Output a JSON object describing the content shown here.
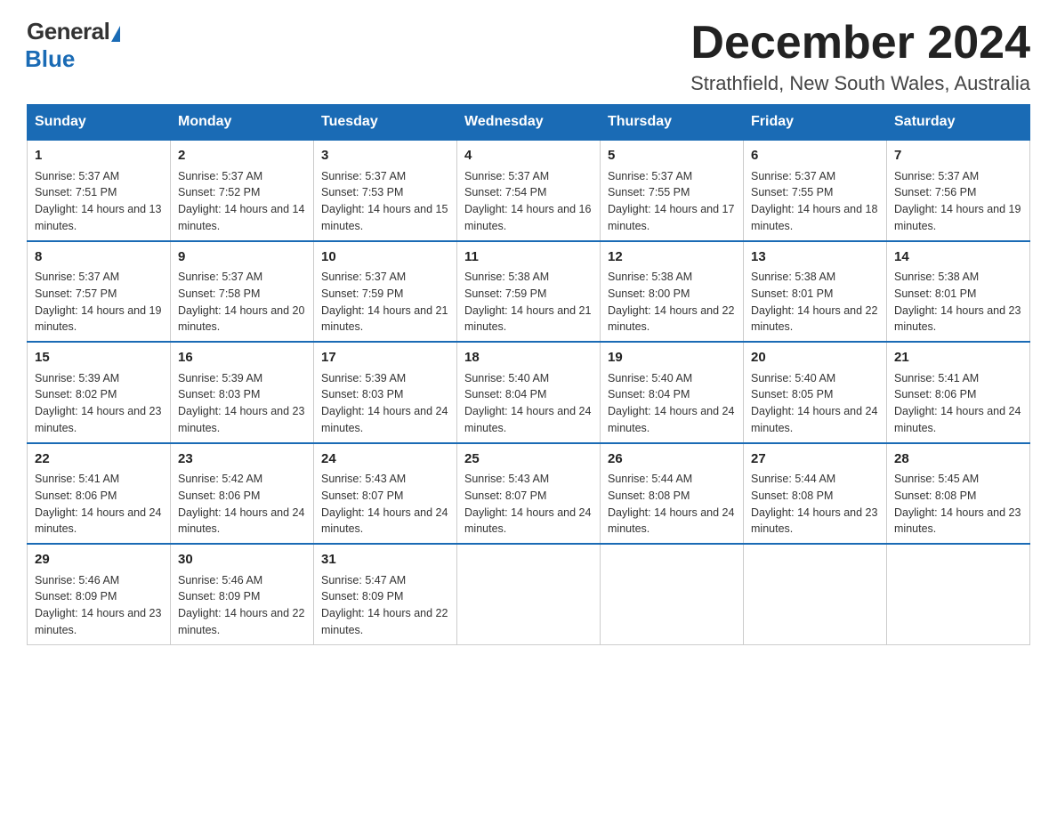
{
  "header": {
    "logo_general": "General",
    "logo_blue": "Blue",
    "month_year": "December 2024",
    "location": "Strathfield, New South Wales, Australia"
  },
  "weekdays": [
    "Sunday",
    "Monday",
    "Tuesday",
    "Wednesday",
    "Thursday",
    "Friday",
    "Saturday"
  ],
  "weeks": [
    [
      {
        "day": "1",
        "sunrise": "5:37 AM",
        "sunset": "7:51 PM",
        "daylight": "14 hours and 13 minutes."
      },
      {
        "day": "2",
        "sunrise": "5:37 AM",
        "sunset": "7:52 PM",
        "daylight": "14 hours and 14 minutes."
      },
      {
        "day": "3",
        "sunrise": "5:37 AM",
        "sunset": "7:53 PM",
        "daylight": "14 hours and 15 minutes."
      },
      {
        "day": "4",
        "sunrise": "5:37 AM",
        "sunset": "7:54 PM",
        "daylight": "14 hours and 16 minutes."
      },
      {
        "day": "5",
        "sunrise": "5:37 AM",
        "sunset": "7:55 PM",
        "daylight": "14 hours and 17 minutes."
      },
      {
        "day": "6",
        "sunrise": "5:37 AM",
        "sunset": "7:55 PM",
        "daylight": "14 hours and 18 minutes."
      },
      {
        "day": "7",
        "sunrise": "5:37 AM",
        "sunset": "7:56 PM",
        "daylight": "14 hours and 19 minutes."
      }
    ],
    [
      {
        "day": "8",
        "sunrise": "5:37 AM",
        "sunset": "7:57 PM",
        "daylight": "14 hours and 19 minutes."
      },
      {
        "day": "9",
        "sunrise": "5:37 AM",
        "sunset": "7:58 PM",
        "daylight": "14 hours and 20 minutes."
      },
      {
        "day": "10",
        "sunrise": "5:37 AM",
        "sunset": "7:59 PM",
        "daylight": "14 hours and 21 minutes."
      },
      {
        "day": "11",
        "sunrise": "5:38 AM",
        "sunset": "7:59 PM",
        "daylight": "14 hours and 21 minutes."
      },
      {
        "day": "12",
        "sunrise": "5:38 AM",
        "sunset": "8:00 PM",
        "daylight": "14 hours and 22 minutes."
      },
      {
        "day": "13",
        "sunrise": "5:38 AM",
        "sunset": "8:01 PM",
        "daylight": "14 hours and 22 minutes."
      },
      {
        "day": "14",
        "sunrise": "5:38 AM",
        "sunset": "8:01 PM",
        "daylight": "14 hours and 23 minutes."
      }
    ],
    [
      {
        "day": "15",
        "sunrise": "5:39 AM",
        "sunset": "8:02 PM",
        "daylight": "14 hours and 23 minutes."
      },
      {
        "day": "16",
        "sunrise": "5:39 AM",
        "sunset": "8:03 PM",
        "daylight": "14 hours and 23 minutes."
      },
      {
        "day": "17",
        "sunrise": "5:39 AM",
        "sunset": "8:03 PM",
        "daylight": "14 hours and 24 minutes."
      },
      {
        "day": "18",
        "sunrise": "5:40 AM",
        "sunset": "8:04 PM",
        "daylight": "14 hours and 24 minutes."
      },
      {
        "day": "19",
        "sunrise": "5:40 AM",
        "sunset": "8:04 PM",
        "daylight": "14 hours and 24 minutes."
      },
      {
        "day": "20",
        "sunrise": "5:40 AM",
        "sunset": "8:05 PM",
        "daylight": "14 hours and 24 minutes."
      },
      {
        "day": "21",
        "sunrise": "5:41 AM",
        "sunset": "8:06 PM",
        "daylight": "14 hours and 24 minutes."
      }
    ],
    [
      {
        "day": "22",
        "sunrise": "5:41 AM",
        "sunset": "8:06 PM",
        "daylight": "14 hours and 24 minutes."
      },
      {
        "day": "23",
        "sunrise": "5:42 AM",
        "sunset": "8:06 PM",
        "daylight": "14 hours and 24 minutes."
      },
      {
        "day": "24",
        "sunrise": "5:43 AM",
        "sunset": "8:07 PM",
        "daylight": "14 hours and 24 minutes."
      },
      {
        "day": "25",
        "sunrise": "5:43 AM",
        "sunset": "8:07 PM",
        "daylight": "14 hours and 24 minutes."
      },
      {
        "day": "26",
        "sunrise": "5:44 AM",
        "sunset": "8:08 PM",
        "daylight": "14 hours and 24 minutes."
      },
      {
        "day": "27",
        "sunrise": "5:44 AM",
        "sunset": "8:08 PM",
        "daylight": "14 hours and 23 minutes."
      },
      {
        "day": "28",
        "sunrise": "5:45 AM",
        "sunset": "8:08 PM",
        "daylight": "14 hours and 23 minutes."
      }
    ],
    [
      {
        "day": "29",
        "sunrise": "5:46 AM",
        "sunset": "8:09 PM",
        "daylight": "14 hours and 23 minutes."
      },
      {
        "day": "30",
        "sunrise": "5:46 AM",
        "sunset": "8:09 PM",
        "daylight": "14 hours and 22 minutes."
      },
      {
        "day": "31",
        "sunrise": "5:47 AM",
        "sunset": "8:09 PM",
        "daylight": "14 hours and 22 minutes."
      },
      null,
      null,
      null,
      null
    ]
  ],
  "labels": {
    "sunrise": "Sunrise:",
    "sunset": "Sunset:",
    "daylight": "Daylight:"
  }
}
